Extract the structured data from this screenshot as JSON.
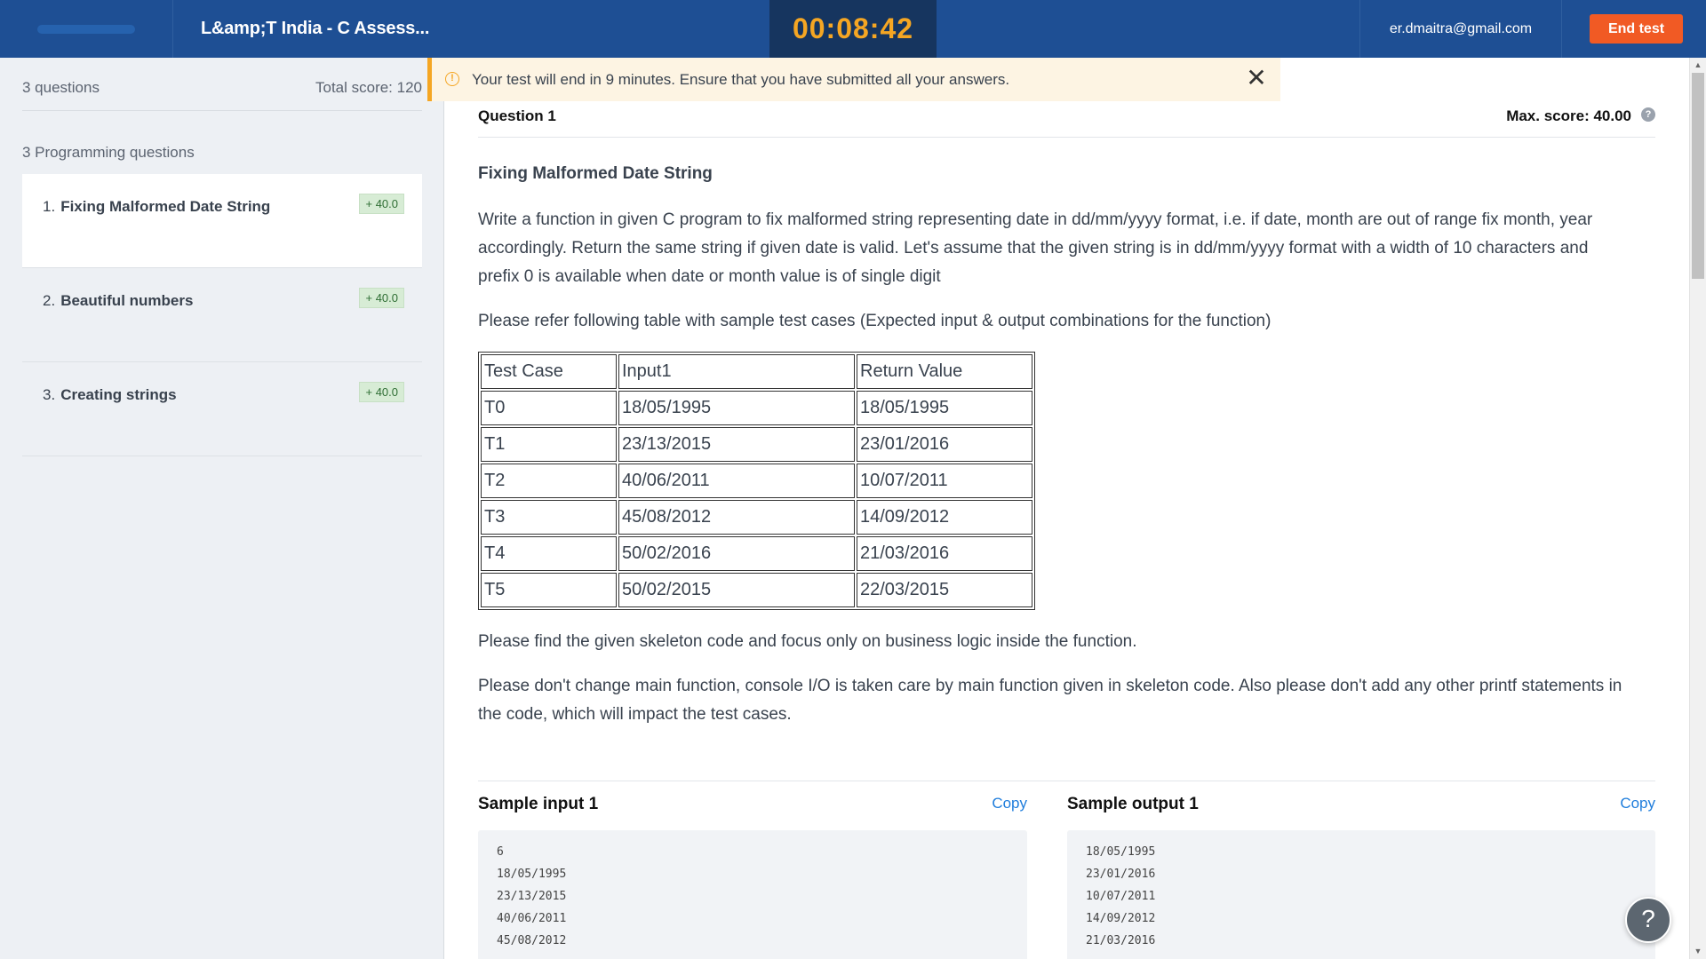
{
  "header": {
    "title": "L&amp;T India - C Assess...",
    "timer": "00:08:42",
    "email": "er.dmaitra@gmail.com",
    "end_label": "End test"
  },
  "sidebar": {
    "question_count": "3 questions",
    "total_score": "Total score: 120",
    "section_label": "3 Programming questions",
    "items": [
      {
        "num": "1.",
        "label": "Fixing Malformed Date String",
        "score": "+ 40.0"
      },
      {
        "num": "2.",
        "label": "Beautiful numbers",
        "score": "+ 40.0"
      },
      {
        "num": "3.",
        "label": "Creating strings",
        "score": "+ 40.0"
      }
    ]
  },
  "notice": {
    "message": "Your test will end in 9 minutes. Ensure that you have submitted all your answers.",
    "close_symbol": "✕"
  },
  "question": {
    "label": "Question  1",
    "max_score": "Max. score: 40.00",
    "title": "Fixing Malformed Date String",
    "para1": "Write a function in given C program to fix malformed string representing date in dd/mm/yyyy format, i.e. if date, month are out of range fix month, year accordingly. Return the same string if given date is valid. Let's assume that the given string is in dd/mm/yyyy format with a width of 10 characters and prefix 0 is available when date or month value is of single digit",
    "para2": "Please refer following table with sample test cases (Expected input & output combinations for the function)",
    "table": {
      "headers": [
        "Test Case",
        "Input1",
        "Return Value"
      ],
      "rows": [
        [
          "T0",
          "18/05/1995",
          "18/05/1995"
        ],
        [
          "T1",
          "23/13/2015",
          "23/01/2016"
        ],
        [
          "T2",
          "40/06/2011",
          "10/07/2011"
        ],
        [
          "T3",
          "45/08/2012",
          "14/09/2012"
        ],
        [
          "T4",
          "50/02/2016",
          "21/03/2016"
        ],
        [
          "T5",
          "50/02/2015",
          "22/03/2015"
        ]
      ]
    },
    "para3": "Please find the given skeleton code and focus only on business logic inside the function.",
    "para4": "Please don't change main function, console I/O is taken care by main function given in skeleton code. Also please don't add any other printf statements in the code, which will impact the test cases."
  },
  "samples": {
    "input_title": "Sample input 1",
    "output_title": "Sample output 1",
    "copy_label": "Copy",
    "input_code": "6\n18/05/1995\n23/13/2015\n40/06/2011\n45/08/2012",
    "output_code": "18/05/1995\n23/01/2016\n10/07/2011\n14/09/2012\n21/03/2016"
  },
  "icons": {
    "warning": "!",
    "help": "?",
    "help_mini": "?",
    "scroll_up": "▲",
    "scroll_down": "▼"
  },
  "colors": {
    "header_bg": "#1e4f94",
    "timer_color": "#f5a623",
    "end_button": "#f15a24",
    "score_badge": "#d7ecd5",
    "notice_accent": "#f5a623",
    "link": "#1f7ddc"
  }
}
